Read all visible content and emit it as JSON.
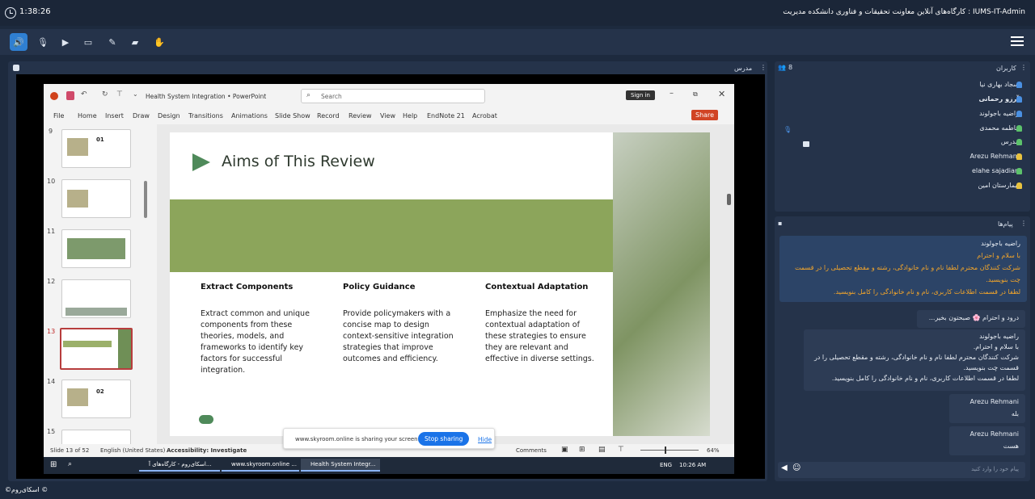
{
  "header": {
    "timer": "1:38:26",
    "room_title": "IUMS-IT-Admin : کارگاه‌های آنلاین معاونت تحقیقات و فناوری دانشکده مدیریت"
  },
  "toolbar": {
    "buttons": [
      "speaker",
      "microphone",
      "camera-off",
      "screen",
      "pen",
      "folder",
      "hand"
    ]
  },
  "share_panel": {
    "label": "مدرس"
  },
  "ppt": {
    "file_title": "Health System Integration • PowerPoint",
    "search_placeholder": "Search",
    "sign_in": "Sign in",
    "ribbon": [
      "File",
      "Home",
      "Insert",
      "Draw",
      "Design",
      "Transitions",
      "Animations",
      "Slide Show",
      "Record",
      "Review",
      "View",
      "Help",
      "EndNote 21",
      "Acrobat"
    ],
    "share_label": "Share",
    "thumb_numbers": [
      "9",
      "10",
      "11",
      "12",
      "13",
      "14",
      "15"
    ],
    "thumb_texts": {
      "t9": "01",
      "t14": "02"
    },
    "slide": {
      "title": "Aims of This Review",
      "columns": [
        {
          "heading": "Extract Components",
          "body": "Extract common and unique components from these theories, models, and frameworks to identify key factors for successful integration."
        },
        {
          "heading": "Policy Guidance",
          "body": "Provide policymakers with a concise map to design context-sensitive integration strategies that improve outcomes and efficiency."
        },
        {
          "heading": "Contextual Adaptation",
          "body": "Emphasize the need for contextual adaptation of these strategies to ensure they are relevant and effective in diverse settings."
        }
      ]
    },
    "status": {
      "slide_no": "Slide 13 of 52",
      "language": "English (United States)",
      "accessibility": "Accessibility: Investigate",
      "comments": "Comments",
      "zoom": "64%"
    },
    "sharing_bar": {
      "text": "www.skyroom.online is sharing your screen.",
      "stop": "Stop sharing",
      "hide": "Hide"
    },
    "taskbar": {
      "apps": [
        "اسکای‌روم - کارگاه‌های آ...",
        "www.skyroom.online ...",
        "Health System Integr..."
      ],
      "lang": "ENG",
      "time": "10:26 AM"
    }
  },
  "users_panel": {
    "title": "کاربران",
    "count": "8",
    "users": [
      "سجاد بهاری نیا",
      "آرزو رحمانی",
      "راضیه باجولوند",
      "فاطمه محمدی",
      "مدرس",
      "Arezu Rehmani",
      "elahe sajadian",
      "بیمارستان امین"
    ]
  },
  "chat_panel": {
    "title": "پیام‌ها",
    "input_placeholder": "پیام خود را وارد کنید",
    "pinned_sender": "راضیه باجولوند",
    "pinned_lines": [
      "با سلام و احترام",
      "شرکت کنندگان محترم لطفا نام و نام خانوادگی، رشته و مقطع تحصیلی را در قسمت چت بنویسید.",
      "لطفا در قسمت اطلاعات کاربری، نام و نام خانوادگی را کامل بنویسید."
    ],
    "greeting": "درود و احترام 🌸 صبحتون بخیر...",
    "quoted_sender": "راضیه باجولوند",
    "quoted_lines": [
      "با سلام و احترام.",
      "شرکت کنندگان محترم لطفا نام و نام خانوادگی، رشته و مقطع تحصیلی را در قسمت چت بنویسید.",
      "لطفا در قسمت اطلاعات کاربری، نام و نام خانوادگی را کامل بنویسید."
    ],
    "reply1_sender": "Arezu Rehmani",
    "reply1_text": "بله",
    "reply2_sender": "Arezu Rehmani",
    "reply2_text": "هست"
  },
  "brand": "©اسکای‌روم ©"
}
